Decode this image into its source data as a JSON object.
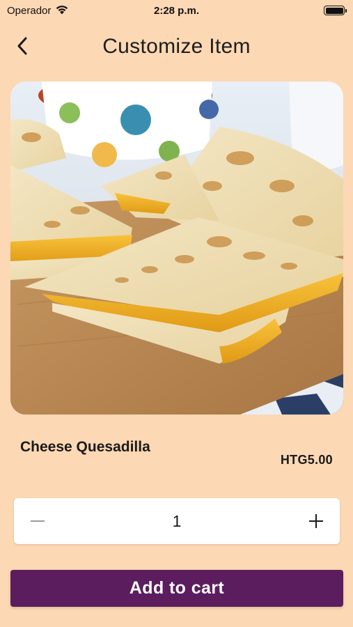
{
  "status_bar": {
    "carrier": "Operador",
    "time": "2:28 p.m.",
    "wifi_icon": "wifi-icon",
    "battery_icon": "battery-full-icon"
  },
  "header": {
    "title": "Customize Item",
    "back_icon": "chevron-left-icon"
  },
  "product": {
    "image": "quesadilla-photo",
    "name": "Cheese Quesadilla",
    "price": "HTG5.00"
  },
  "quantity": {
    "value": "1",
    "decrement_icon": "minus-icon",
    "increment_icon": "plus-icon"
  },
  "actions": {
    "add_to_cart_label": "Add to cart"
  },
  "colors": {
    "background": "#fcd8b4",
    "primary_button": "#5b1d5e",
    "stepper_background": "#ffffff",
    "text": "#1a1a1a"
  }
}
